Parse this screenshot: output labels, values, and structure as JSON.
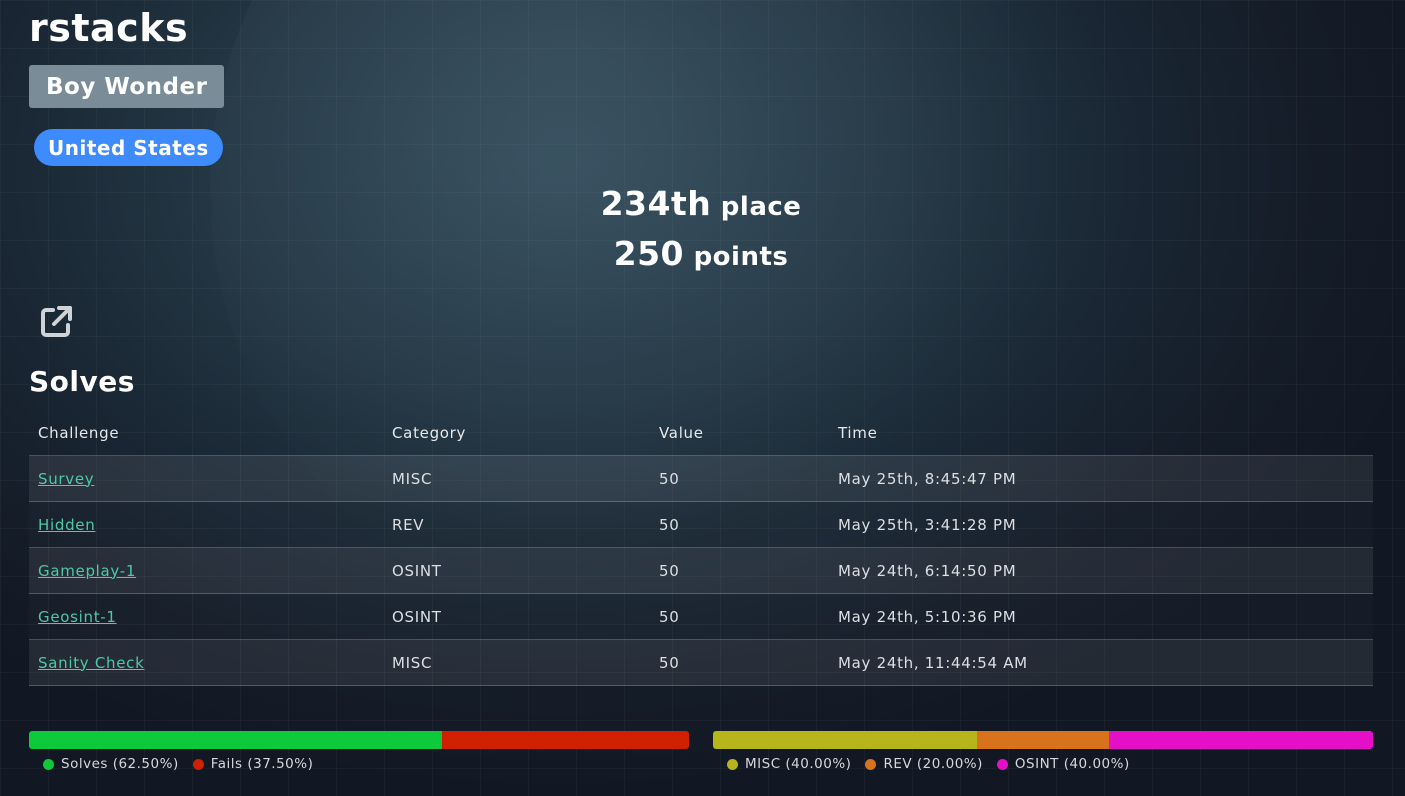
{
  "profile": {
    "username": "rstacks",
    "division": "Boy Wonder",
    "country": "United States",
    "place_number": "234th",
    "place_suffix": "place",
    "points_number": "250",
    "points_suffix": "points"
  },
  "solves": {
    "heading": "Solves",
    "columns": [
      "Challenge",
      "Category",
      "Value",
      "Time"
    ],
    "rows": [
      {
        "challenge": "Survey",
        "category": "MISC",
        "value": "50",
        "time": "May 25th, 8:45:47 PM"
      },
      {
        "challenge": "Hidden",
        "category": "REV",
        "value": "50",
        "time": "May 25th, 3:41:28 PM"
      },
      {
        "challenge": "Gameplay-1",
        "category": "OSINT",
        "value": "50",
        "time": "May 24th, 6:14:50 PM"
      },
      {
        "challenge": "Geosint-1",
        "category": "OSINT",
        "value": "50",
        "time": "May 24th, 5:10:36 PM"
      },
      {
        "challenge": "Sanity Check",
        "category": "MISC",
        "value": "50",
        "time": "May 24th, 11:44:54 AM"
      }
    ]
  },
  "solve_ratio": {
    "segments": [
      {
        "label": "Solves (62.50%)",
        "percent": 62.5,
        "color": "#0ec93a"
      },
      {
        "label": "Fails (37.50%)",
        "percent": 37.5,
        "color": "#d02000"
      }
    ]
  },
  "category_breakdown": {
    "segments": [
      {
        "label": "MISC (40.00%)",
        "percent": 40,
        "color": "#b7b41c"
      },
      {
        "label": "REV (20.00%)",
        "percent": 20,
        "color": "#d8731c"
      },
      {
        "label": "OSINT (40.00%)",
        "percent": 40,
        "color": "#e60fc8"
      }
    ]
  },
  "icons": {
    "share": "external-link-icon"
  }
}
